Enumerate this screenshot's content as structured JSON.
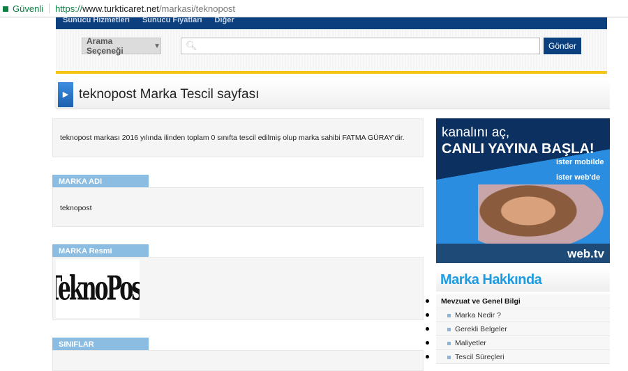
{
  "browser": {
    "secure_label": "Güvenli",
    "url_scheme": "https://",
    "url_host": "www.turkticaret.net",
    "url_path": "/markasi/teknopost"
  },
  "nav": {
    "items": [
      "Sunucu Hizmetleri",
      "Sunucu Fiyatları",
      "Diğer"
    ]
  },
  "search": {
    "options_label": "Arama Seçeneği",
    "placeholder": "",
    "submit_label": "Gönder"
  },
  "page": {
    "title": "teknopost Marka Tescil sayfası",
    "summary": "teknopost markası 2016 yılında ilinden toplam 0 sınıfta tescil edilmiş olup marka sahibi FATMA GÜRAY'dir."
  },
  "sections": {
    "name_header": "MARKA ADI",
    "name_value": "teknopost",
    "image_header": "MARKA Resmi",
    "logo_text": "TeknoPost",
    "classes_header": "SINIFLAR"
  },
  "ad": {
    "line1": "kanalını aç,",
    "line2": "CANLI YAYINA BAŞLA!",
    "line3": "ister mobilde",
    "line4": "ister web'de",
    "brand": "web.tv"
  },
  "sidebar": {
    "title": "Marka Hakkında",
    "items": [
      "Mevzuat ve Genel Bilgi",
      "Marka Nedir ?",
      "Gerekli Belgeler",
      "Maliyetler",
      "Tescil Süreçleri"
    ]
  },
  "colors": {
    "nav": "#0b3f7e",
    "accent": "#f5c518",
    "section_header": "#8bbde2",
    "sidebar_title": "#1e9ae0"
  }
}
